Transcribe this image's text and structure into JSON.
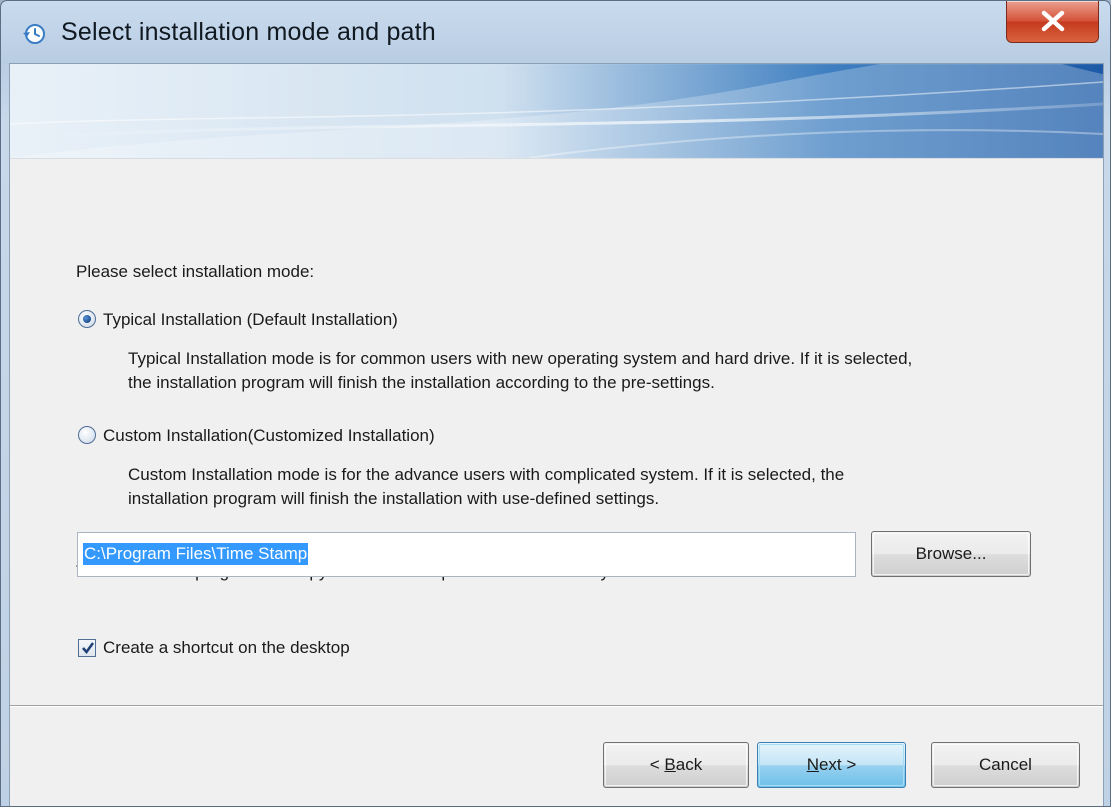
{
  "window": {
    "title": "Select installation mode and path",
    "icon": "history-clock-icon",
    "close_icon": "close-icon"
  },
  "content": {
    "mode_prompt": "Please select installation mode:",
    "typical": {
      "label": "Typical Installation (Default Installation)",
      "selected": true,
      "desc_line1": "Typical Installation mode is for common users with new operating system and hard drive. If it is selected,",
      "desc_line2": "the installation program will finish the installation according to the pre-settings."
    },
    "custom": {
      "label": "Custom Installation(Customized Installation)",
      "selected": false,
      "desc_line1": "Custom Installation mode is for the advance users with complicated system. If it is selected, the",
      "desc_line2": "installation program will finish the installation with use-defined settings."
    },
    "path_prompt": "The installation program will copy all \"Time Stamp\" files to the directory below:",
    "path_value": "C:\\Program Files\\Time Stamp",
    "browse_label": "Browse...",
    "shortcut": {
      "label": "Create a shortcut on the desktop",
      "checked": true
    }
  },
  "footer": {
    "back_prefix": "< ",
    "back_mnemonic": "B",
    "back_rest": "ack",
    "next_mnemonic": "N",
    "next_rest": "ext >",
    "cancel_label": "Cancel"
  },
  "colors": {
    "selection": "#3399ff",
    "close_button": "#c53a1f",
    "default_button": "#98d1ef"
  }
}
